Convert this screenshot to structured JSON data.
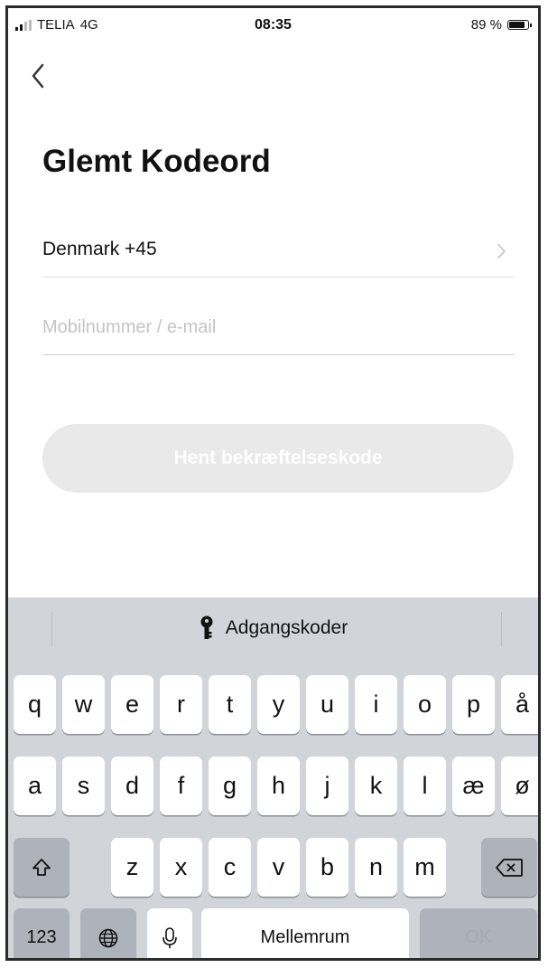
{
  "status_bar": {
    "carrier": "TELIA",
    "network": "4G",
    "time": "08:35",
    "battery_percent_label": "89 %",
    "battery_level": 0.89
  },
  "screen": {
    "back_icon": "chevron-left-icon",
    "title": "Glemt Kodeord",
    "country_selector": {
      "label": "Denmark +45",
      "icon": "chevron-right-icon"
    },
    "phone_email_input": {
      "value": "",
      "placeholder": "Mobilnummer / e-mail"
    },
    "submit_button": {
      "label": "Hent bekræftelseskode",
      "enabled": false,
      "background": "#e9e9e9"
    }
  },
  "keyboard": {
    "suggestion": {
      "icon": "key-icon",
      "label": "Adgangskoder"
    },
    "rows": [
      [
        "q",
        "w",
        "e",
        "r",
        "t",
        "y",
        "u",
        "i",
        "o",
        "p",
        "å"
      ],
      [
        "a",
        "s",
        "d",
        "f",
        "g",
        "h",
        "j",
        "k",
        "l",
        "æ",
        "ø"
      ],
      [
        "z",
        "x",
        "c",
        "v",
        "b",
        "n",
        "m"
      ]
    ],
    "shift_icon": "shift-arrow-icon",
    "delete_icon": "delete-backspace-icon",
    "numbers_label": "123",
    "globe_icon": "globe-icon",
    "mic_icon": "microphone-icon",
    "space_label": "Mellemrum",
    "ok_label": "OK"
  },
  "colors": {
    "keyboard_bg": "#d1d4d9",
    "key_bg": "#ffffff",
    "func_key_bg": "#adb2bb",
    "disabled_text": "#a8abb0"
  }
}
